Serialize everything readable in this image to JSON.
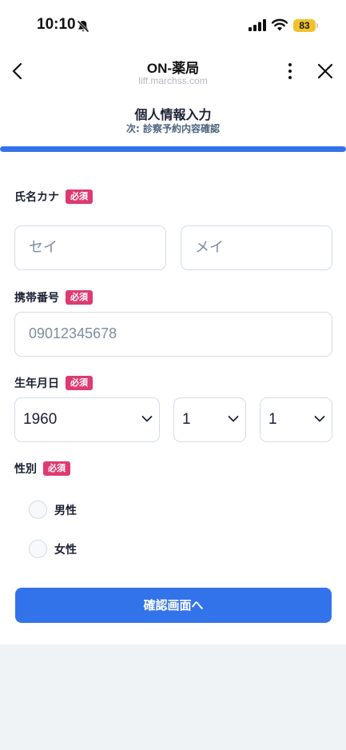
{
  "status_bar": {
    "time": "10:10",
    "battery": "83",
    "icons": [
      "bell-slash-icon",
      "cellular-signal-icon",
      "wifi-icon",
      "battery-icon"
    ]
  },
  "header": {
    "title": "ON-薬局",
    "url": "liff.marchss.com",
    "icons": [
      "chevron-left-icon",
      "more-vertical-icon",
      "close-icon"
    ]
  },
  "step": {
    "title": "個人情報入力",
    "next": "次: 診察予約内容確認",
    "progress": 1.0
  },
  "form": {
    "required_badge": "必須",
    "kana": {
      "label": "氏名カナ",
      "sei_placeholder": "セイ",
      "mei_placeholder": "メイ"
    },
    "phone": {
      "label": "携帯番号",
      "placeholder": "09012345678"
    },
    "birth": {
      "label": "生年月日",
      "year": "1960",
      "month": "1",
      "day": "1"
    },
    "gender": {
      "label": "性別",
      "options": [
        "男性",
        "女性"
      ]
    },
    "submit_label": "確認画面へ"
  },
  "colors": {
    "accent": "#3373ea",
    "required": "#de3a72",
    "battery": "#f1c12b",
    "border": "#d3dde6"
  }
}
